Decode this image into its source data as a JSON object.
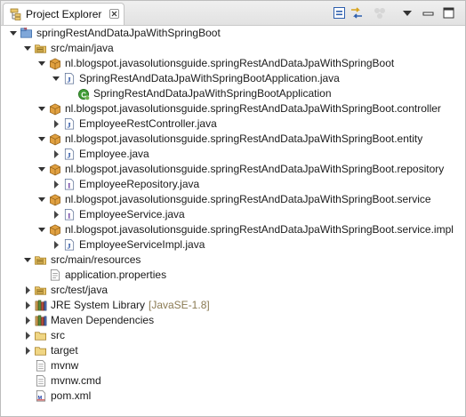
{
  "view": {
    "tab_label": "Project Explorer",
    "tab_icon": "project-explorer-icon",
    "toolbar": [
      {
        "name": "collapse-all-icon"
      },
      {
        "name": "link-with-editor-icon"
      },
      {
        "name": "focus-task-icon"
      },
      {
        "name": "view-menu-icon"
      },
      {
        "name": "minimize-icon"
      },
      {
        "name": "maximize-icon"
      }
    ]
  },
  "tree": [
    {
      "label": "springRestAndDataJpaWithSpringBoot",
      "icon": "maven-project-icon",
      "depth": 0,
      "expanded": true
    },
    {
      "label": "src/main/java",
      "icon": "source-folder-icon",
      "depth": 1,
      "expanded": true
    },
    {
      "label": "nl.blogspot.javasolutionsguide.springRestAndDataJpaWithSpringBoot",
      "icon": "package-icon",
      "depth": 2,
      "expanded": true
    },
    {
      "label": "SpringRestAndDataJpaWithSpringBootApplication.java",
      "icon": "java-file-icon",
      "depth": 3,
      "expanded": true
    },
    {
      "label": "SpringRestAndDataJpaWithSpringBootApplication",
      "icon": "spring-boot-class-icon",
      "depth": 4,
      "expanded": null
    },
    {
      "label": "nl.blogspot.javasolutionsguide.springRestAndDataJpaWithSpringBoot.controller",
      "icon": "package-icon",
      "depth": 2,
      "expanded": true
    },
    {
      "label": "EmployeeRestController.java",
      "icon": "java-file-icon",
      "depth": 3,
      "expanded": false
    },
    {
      "label": "nl.blogspot.javasolutionsguide.springRestAndDataJpaWithSpringBoot.entity",
      "icon": "package-icon",
      "depth": 2,
      "expanded": true
    },
    {
      "label": "Employee.java",
      "icon": "java-file-icon",
      "depth": 3,
      "expanded": false
    },
    {
      "label": "nl.blogspot.javasolutionsguide.springRestAndDataJpaWithSpringBoot.repository",
      "icon": "package-icon",
      "depth": 2,
      "expanded": true
    },
    {
      "label": "EmployeeRepository.java",
      "icon": "java-interface-file-icon",
      "depth": 3,
      "expanded": false
    },
    {
      "label": "nl.blogspot.javasolutionsguide.springRestAndDataJpaWithSpringBoot.service",
      "icon": "package-icon",
      "depth": 2,
      "expanded": true
    },
    {
      "label": "EmployeeService.java",
      "icon": "java-interface-file-icon",
      "depth": 3,
      "expanded": false
    },
    {
      "label": "nl.blogspot.javasolutionsguide.springRestAndDataJpaWithSpringBoot.service.impl",
      "icon": "package-icon",
      "depth": 2,
      "expanded": true
    },
    {
      "label": "EmployeeServiceImpl.java",
      "icon": "java-file-icon",
      "depth": 3,
      "expanded": false
    },
    {
      "label": "src/main/resources",
      "icon": "source-folder-icon",
      "depth": 1,
      "expanded": true
    },
    {
      "label": "application.properties",
      "icon": "properties-file-icon",
      "depth": 2,
      "expanded": null
    },
    {
      "label": "src/test/java",
      "icon": "source-folder-icon",
      "depth": 1,
      "expanded": false
    },
    {
      "label": "JRE System Library",
      "decoration": "[JavaSE-1.8]",
      "icon": "library-icon",
      "depth": 1,
      "expanded": false
    },
    {
      "label": "Maven Dependencies",
      "icon": "library-icon",
      "depth": 1,
      "expanded": false
    },
    {
      "label": "src",
      "icon": "folder-icon",
      "depth": 1,
      "expanded": false
    },
    {
      "label": "target",
      "icon": "folder-icon",
      "depth": 1,
      "expanded": false
    },
    {
      "label": "mvnw",
      "icon": "text-file-icon",
      "depth": 1,
      "expanded": null
    },
    {
      "label": "mvnw.cmd",
      "icon": "text-file-icon",
      "depth": 1,
      "expanded": null
    },
    {
      "label": "pom.xml",
      "icon": "xml-file-icon",
      "depth": 1,
      "expanded": null
    }
  ]
}
